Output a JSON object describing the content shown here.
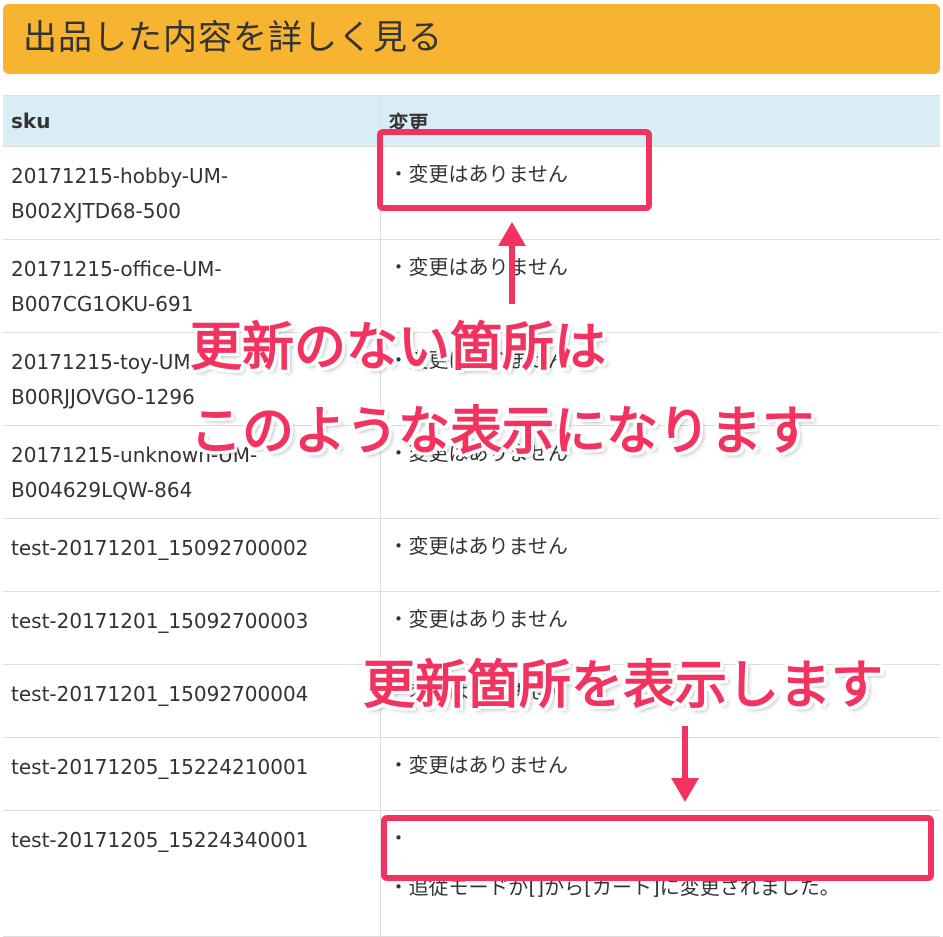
{
  "page": {
    "title": "出品した内容を詳しく見る"
  },
  "table": {
    "headers": [
      "sku",
      "変更"
    ],
    "rows": [
      {
        "sku": [
          "20171215-hobby-UM-",
          "B002XJTD68-500"
        ],
        "changes": [
          "・変更はありません"
        ]
      },
      {
        "sku": [
          "20171215-office-UM-",
          "B007CG1OKU-691"
        ],
        "changes": [
          "・変更はありません"
        ]
      },
      {
        "sku": [
          "20171215-toy-UM-",
          "B00RJJOVGO-1296"
        ],
        "changes": [
          "・変更はありません"
        ]
      },
      {
        "sku": [
          "20171215-unknown-UM-",
          "B004629LQW-864"
        ],
        "changes": [
          "・変更はありません"
        ]
      },
      {
        "sku": [
          "test-20171201_15092700002"
        ],
        "changes": [
          "・変更はありません"
        ]
      },
      {
        "sku": [
          "test-20171201_15092700003"
        ],
        "changes": [
          "・変更はありません"
        ]
      },
      {
        "sku": [
          "test-20171201_15092700004"
        ],
        "changes": [
          "・変更はありません"
        ]
      },
      {
        "sku": [
          "test-20171205_15224210001"
        ],
        "changes": [
          "・変更はありません"
        ]
      },
      {
        "sku": [
          "test-20171205_15224340001"
        ],
        "changes": [
          "・",
          "・追従モードが[]から[カート]に変更されました。"
        ]
      }
    ]
  },
  "annotations": {
    "callout_no_update_line1": "更新のない箇所は",
    "callout_no_update_line2": "このような表示になります",
    "callout_update": "更新箇所を表示します",
    "accent_color": "#f2325f"
  },
  "colors": {
    "title_bar": "#f6b431",
    "table_header": "#d9edf7"
  }
}
